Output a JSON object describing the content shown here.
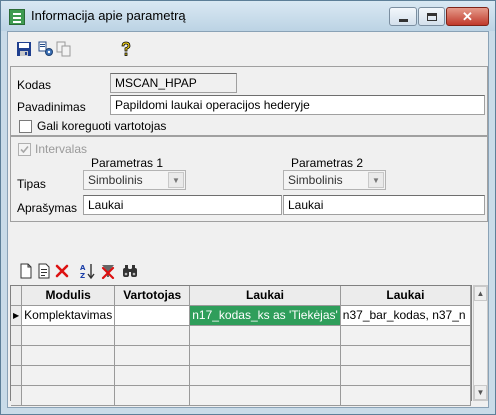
{
  "window": {
    "title": "Informacija apie parametrą",
    "close_glyph": "✕"
  },
  "toolbar": {
    "icons": [
      "save-icon",
      "copy-settings-icon",
      "copy-icon",
      "help-icon"
    ]
  },
  "form": {
    "kodas_label": "Kodas",
    "kodas_value": "MSCAN_HPAP",
    "pavadinimas_label": "Pavadinimas",
    "pavadinimas_value": "Papildomi laukai operacijos hederyje",
    "user_editable_label": "Gali koreguoti vartotojas",
    "user_editable_checked": false
  },
  "interval": {
    "label": "Intervalas",
    "checked": true,
    "param1_header": "Parametras 1",
    "param2_header": "Parametras 2",
    "tipas_label": "Tipas",
    "tipas1_value": "Simbolinis",
    "tipas2_value": "Simbolinis",
    "aprasymas_label": "Aprašymas",
    "aprasymas1_value": "Laukai",
    "aprasymas2_value": "Laukai"
  },
  "grid_toolbar": {
    "icons": [
      "new-document-icon",
      "edit-document-icon",
      "delete-icon",
      "sort-az-icon",
      "clear-filter-icon",
      "find-icon"
    ]
  },
  "grid": {
    "columns": [
      "Modulis",
      "Vartotojas",
      "Laukai",
      "Laukai"
    ],
    "rows": [
      [
        "Komplektavimas",
        "",
        "n17_kodas_ks as 'Tiekėjas'",
        "n37_bar_kodas, n37_n"
      ]
    ],
    "row_indicator": "▶"
  }
}
